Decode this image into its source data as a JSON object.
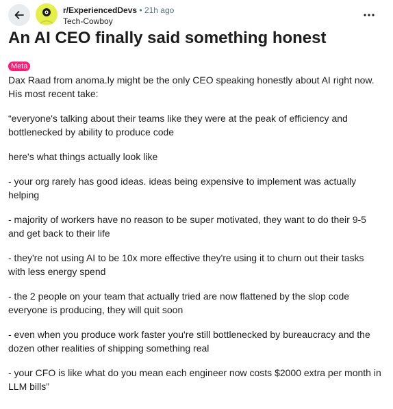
{
  "post": {
    "subreddit": "r/ExperiencedDevs",
    "separator": "•",
    "time": "21h ago",
    "author": "Tech-Cowboy",
    "title": "An AI CEO finally said something honest",
    "flair": "Meta",
    "flair_color": "#ff1a75",
    "avatar_color": "#e5ef4a",
    "paragraphs": [
      "Dax Raad from anoma.ly might be the only CEO speaking honestly about AI right now. His most recent take:",
      "“everyone's talking about their teams like they were at the peak of efficiency and bottlenecked by ability to produce code",
      "here's what things actually look like",
      "- your org rarely has good ideas. ideas being expensive to implement was actually helping",
      "- majority of workers have no reason to be super motivated, they want to do their 9-5 and get back to their life",
      "- they're not using AI to be 10x more effective they're using it to churn out their tasks with less energy spend",
      "- the 2 people on your team that actually tried are now flattened by the slop code everyone is producing, they will quit soon",
      "- even when you produce work faster you're still bottlenecked by bureaucracy and the dozen other realities of shipping something real",
      "- your CFO is like what do you mean each engineer now costs $2000 extra per month in LLM bills”"
    ]
  },
  "icons": {
    "back": "arrow-left-icon",
    "avatar": "subreddit-avatar",
    "more": "more-options-icon"
  }
}
